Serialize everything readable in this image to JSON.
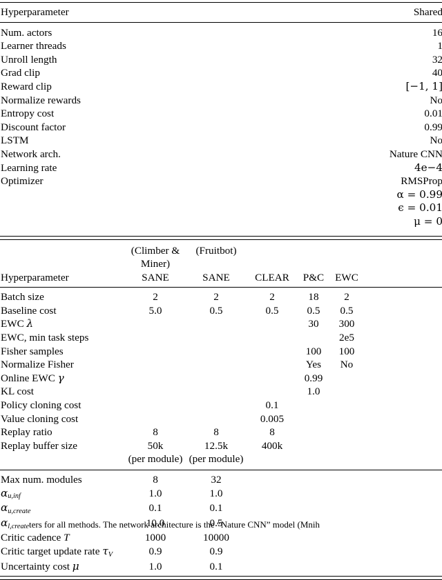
{
  "document": {
    "kind": "academic-paper-table-page",
    "caption_fragment": "ters for all methods. The network architecture is the “Nature CNN” model (Mnih"
  },
  "table1": {
    "header": {
      "param": "Hyperparameter",
      "value": "Shared"
    },
    "rows": [
      {
        "name": "Num. actors",
        "value": "16"
      },
      {
        "name": "Learner threads",
        "value": "1"
      },
      {
        "name": "Unroll length",
        "value": "32"
      },
      {
        "name": "Grad clip",
        "value": "40"
      },
      {
        "name": "Reward clip",
        "value": "[−1, 1]"
      },
      {
        "name": "Normalize rewards",
        "value": "No"
      },
      {
        "name": "Entropy cost",
        "value": "0.01"
      },
      {
        "name": "Discount factor",
        "value": "0.99"
      },
      {
        "name": "LSTM",
        "value": "No"
      },
      {
        "name": "Network arch.",
        "value": "Nature CNN"
      },
      {
        "name": "Learning rate",
        "value": "4e−4"
      },
      {
        "name": "Optimizer",
        "value": "RMSProp"
      },
      {
        "name": "",
        "value": "α = 0.99"
      },
      {
        "name": "",
        "value": "ϵ = 0.01"
      },
      {
        "name": "",
        "value": "μ = 0"
      }
    ]
  },
  "table2": {
    "header": {
      "param": "Hyperparameter",
      "group1_top": "(Climber & Miner)",
      "group1_bottom": "SANE",
      "group2_top": "(Fruitbot)",
      "group2_bottom": "SANE",
      "clear": "CLEAR",
      "pc": "P&C",
      "ewc": "EWC"
    },
    "section1": [
      {
        "name": "Batch size",
        "sane1": "2",
        "sane2": "2",
        "clear": "2",
        "pc": "18",
        "ewc": "2"
      },
      {
        "name": "Baseline cost",
        "sane1": "5.0",
        "sane2": "0.5",
        "clear": "0.5",
        "pc": "0.5",
        "ewc": "0.5"
      },
      {
        "name": "EWC λ",
        "name_math": true,
        "sane1": "",
        "sane2": "",
        "clear": "",
        "pc": "30",
        "ewc": "300"
      },
      {
        "name": "EWC, min task steps",
        "sane1": "",
        "sane2": "",
        "clear": "",
        "pc": "",
        "ewc": "2e5"
      },
      {
        "name": "Fisher samples",
        "sane1": "",
        "sane2": "",
        "clear": "",
        "pc": "100",
        "ewc": "100"
      },
      {
        "name": "Normalize Fisher",
        "sane1": "",
        "sane2": "",
        "clear": "",
        "pc": "Yes",
        "ewc": "No"
      },
      {
        "name": "Online EWC γ",
        "sane1": "",
        "sane2": "",
        "clear": "",
        "pc": "0.99",
        "ewc": ""
      },
      {
        "name": "KL cost",
        "sane1": "",
        "sane2": "",
        "clear": "",
        "pc": "1.0",
        "ewc": ""
      },
      {
        "name": "Policy cloning cost",
        "sane1": "",
        "sane2": "",
        "clear": "0.1",
        "pc": "",
        "ewc": ""
      },
      {
        "name": "Value cloning cost",
        "sane1": "",
        "sane2": "",
        "clear": "0.005",
        "pc": "",
        "ewc": ""
      },
      {
        "name": "Replay ratio",
        "sane1": "8",
        "sane2": "8",
        "clear": "8",
        "pc": "",
        "ewc": ""
      },
      {
        "name": "Replay buffer size",
        "sane1": "50k",
        "sane2": "12.5k",
        "clear": "400k",
        "pc": "",
        "ewc": ""
      },
      {
        "name": "",
        "sane1": "(per module)",
        "sane2": "(per module)",
        "clear": "",
        "pc": "",
        "ewc": ""
      }
    ],
    "section2": [
      {
        "name": "Max num. modules",
        "sane1": "8",
        "sane2": "32"
      },
      {
        "name": "α_{u,inf}",
        "sane1": "1.0",
        "sane2": "1.0"
      },
      {
        "name": "α_{u,create}",
        "sane1": "0.1",
        "sane2": "0.1"
      },
      {
        "name": "α_{l,create}",
        "sane1": "10.0",
        "sane2": "0.5"
      },
      {
        "name": "Critic cadence T",
        "sane1": "1000",
        "sane2": "10000"
      },
      {
        "name": "Critic target update rate τ_V",
        "sane1": "0.9",
        "sane2": "0.9"
      },
      {
        "name": "Uncertainty cost μ",
        "sane1": "1.0",
        "sane2": "0.1"
      }
    ],
    "section2_labels": {
      "alpha_u_inf": {
        "base": "α",
        "sub": "u,inf"
      },
      "alpha_u_create": {
        "base": "α",
        "sub": "u,create"
      },
      "alpha_l_create": {
        "base": "α",
        "sub": "l,create"
      },
      "critic_cadence": {
        "text": "Critic cadence ",
        "sym": "T"
      },
      "critic_target": {
        "text": "Critic target update rate ",
        "sym": "τ",
        "sub": "V"
      },
      "uncertainty": {
        "text": "Uncertainty cost ",
        "sym": "μ"
      }
    }
  },
  "colors": {
    "text": "#000000",
    "rule": "#000000",
    "background": "#ffffff"
  }
}
